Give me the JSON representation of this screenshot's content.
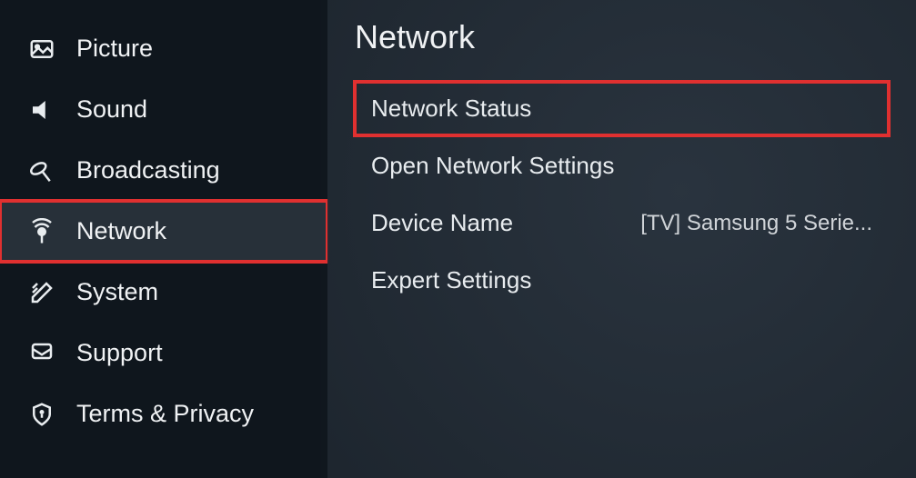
{
  "sidebar": {
    "items": [
      {
        "label": "Picture"
      },
      {
        "label": "Sound"
      },
      {
        "label": "Broadcasting"
      },
      {
        "label": "Network"
      },
      {
        "label": "System"
      },
      {
        "label": "Support"
      },
      {
        "label": "Terms & Privacy"
      }
    ]
  },
  "main": {
    "title": "Network",
    "items": [
      {
        "label": "Network Status",
        "value": ""
      },
      {
        "label": "Open Network Settings",
        "value": ""
      },
      {
        "label": "Device Name",
        "value": "[TV] Samsung 5 Serie..."
      },
      {
        "label": "Expert Settings",
        "value": ""
      }
    ]
  }
}
